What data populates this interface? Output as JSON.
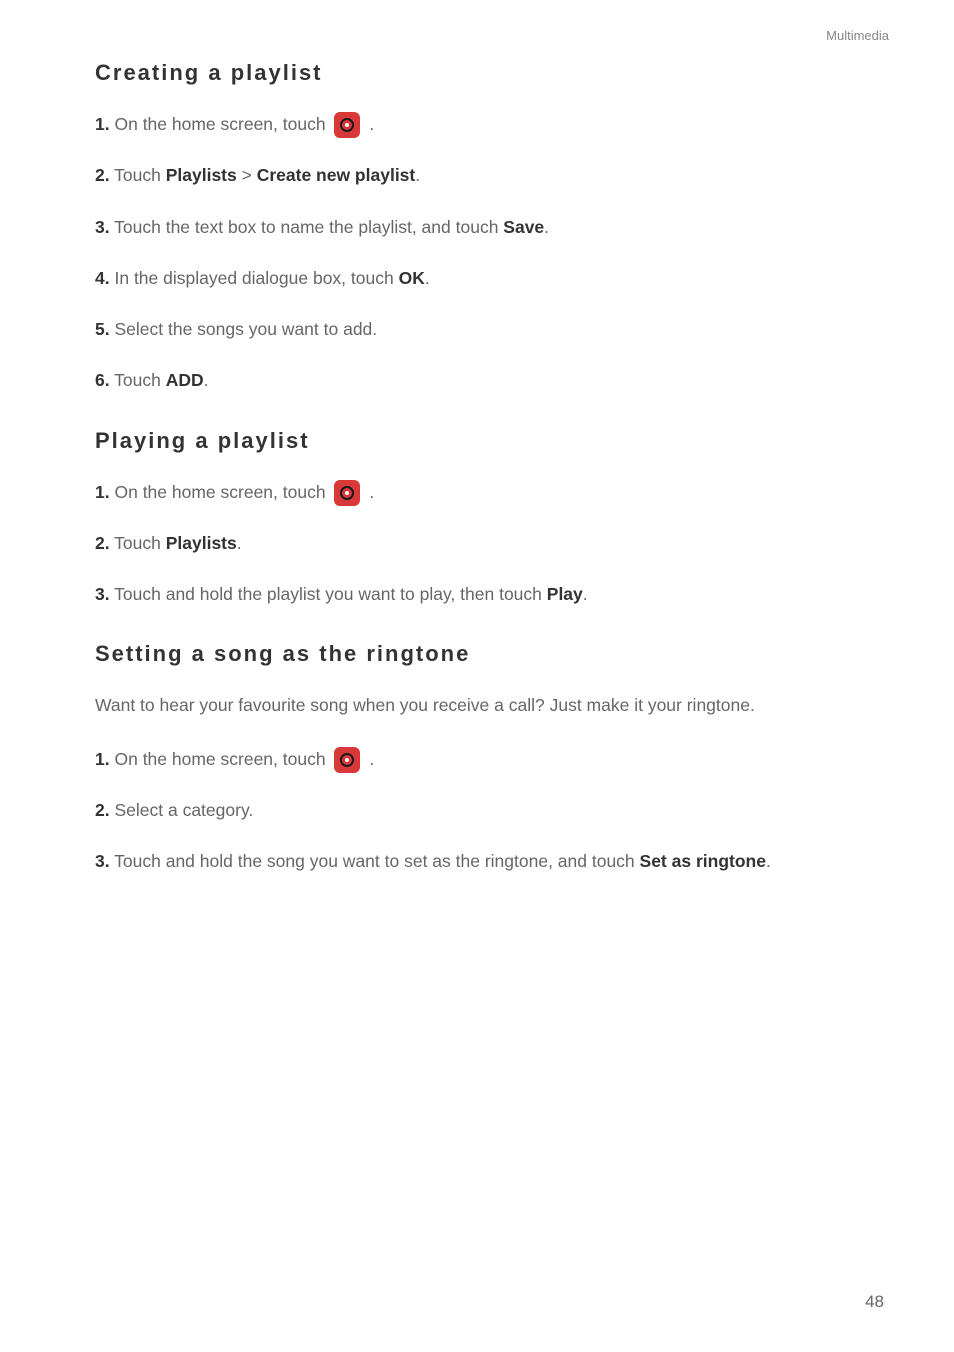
{
  "header": {
    "label": "Multimedia"
  },
  "sections": [
    {
      "title": "Creating a playlist",
      "steps": [
        {
          "num": "1.",
          "pre": "On the home screen, touch ",
          "icon": true,
          "post": " ."
        },
        {
          "num": "2.",
          "pre": "Touch ",
          "b1": "Playlists",
          "mid": " > ",
          "b2": "Create new playlist",
          "post": "."
        },
        {
          "num": "3.",
          "pre": "Touch the text box to name the playlist, and touch ",
          "b1": "Save",
          "post": "."
        },
        {
          "num": "4.",
          "pre": "In the displayed dialogue box, touch ",
          "b1": "OK",
          "post": "."
        },
        {
          "num": "5.",
          "pre": "Select the songs you want to add."
        },
        {
          "num": "6.",
          "pre": "Touch ",
          "b1": "ADD",
          "post": "."
        }
      ]
    },
    {
      "title": "Playing a playlist",
      "steps": [
        {
          "num": "1.",
          "pre": "On the home screen, touch ",
          "icon": true,
          "post": " ."
        },
        {
          "num": "2.",
          "pre": "Touch ",
          "b1": "Playlists",
          "post": "."
        },
        {
          "num": "3.",
          "pre": "Touch and hold the playlist you want to play, then touch ",
          "b1": "Play",
          "post": "."
        }
      ]
    },
    {
      "title": "Setting a song as the ringtone",
      "intro": "Want to hear your favourite song when you receive a call? Just make it your ringtone.",
      "steps": [
        {
          "num": "1.",
          "pre": "On the home screen, touch ",
          "icon": true,
          "post": " ."
        },
        {
          "num": "2.",
          "pre": "Select a category."
        },
        {
          "num": "3.",
          "pre": "Touch and hold the song you want to set as the ringtone, and touch ",
          "b1": "Set as ringtone",
          "post": "."
        }
      ]
    }
  ],
  "page": "48"
}
